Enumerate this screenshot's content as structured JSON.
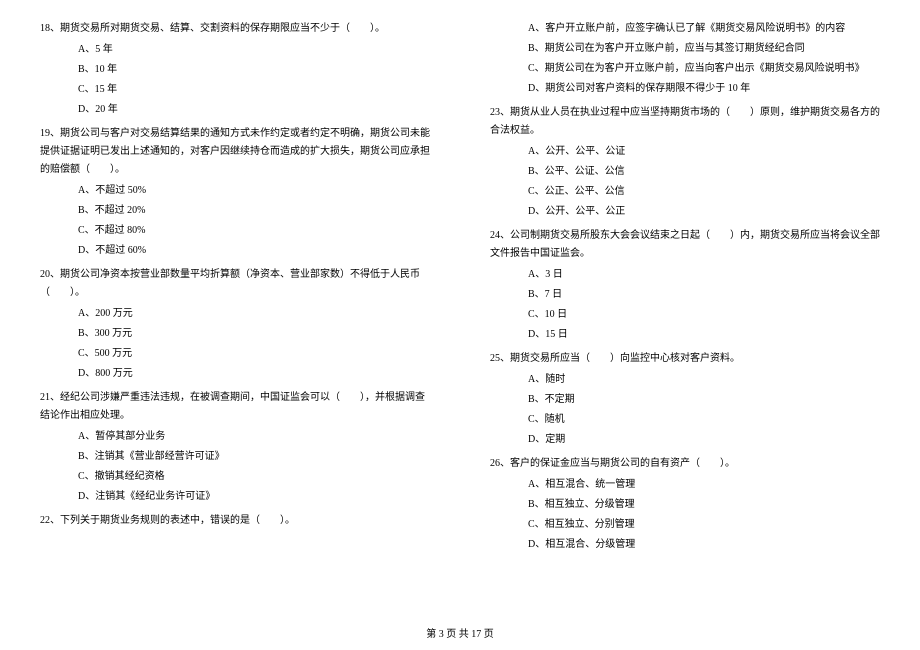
{
  "left_column": {
    "q18": {
      "text": "18、期货交易所对期货交易、结算、交割资料的保存期限应当不少于（　　）。",
      "options": [
        "A、5 年",
        "B、10 年",
        "C、15 年",
        "D、20 年"
      ]
    },
    "q19": {
      "text": "19、期货公司与客户对交易结算结果的通知方式未作约定或者约定不明确，期货公司未能提供证据证明已发出上述通知的，对客户因继续持仓而造成的扩大损失，期货公司应承担的赔偿额（　　）。",
      "options": [
        "A、不超过 50%",
        "B、不超过 20%",
        "C、不超过 80%",
        "D、不超过 60%"
      ]
    },
    "q20": {
      "text": "20、期货公司净资本按营业部数量平均折算额（净资本、营业部家数）不得低于人民币（　　）。",
      "options": [
        "A、200 万元",
        "B、300 万元",
        "C、500 万元",
        "D、800 万元"
      ]
    },
    "q21": {
      "text": "21、经纪公司涉嫌严重违法违规，在被调查期间，中国证监会可以（　　），并根据调查结论作出相应处理。",
      "options": [
        "A、暂停其部分业务",
        "B、注销其《营业部经营许可证》",
        "C、撤销其经纪资格",
        "D、注销其《经纪业务许可证》"
      ]
    },
    "q22": {
      "text": "22、下列关于期货业务规则的表述中，错误的是（　　）。"
    }
  },
  "right_column": {
    "q22_options": [
      "A、客户开立账户前，应签字确认已了解《期货交易风险说明书》的内容",
      "B、期货公司在为客户开立账户前，应当与其签订期货经纪合同",
      "C、期货公司在为客户开立账户前，应当向客户出示《期货交易风险说明书》",
      "D、期货公司对客户资料的保存期限不得少于 10 年"
    ],
    "q23": {
      "text": "23、期货从业人员在执业过程中应当坚持期货市场的（　　）原则，维护期货交易各方的合法权益。",
      "options": [
        "A、公开、公平、公证",
        "B、公平、公证、公信",
        "C、公正、公平、公信",
        "D、公开、公平、公正"
      ]
    },
    "q24": {
      "text": "24、公司制期货交易所股东大会会议结束之日起（　　）内，期货交易所应当将会议全部文件报告中国证监会。",
      "options": [
        "A、3 日",
        "B、7 日",
        "C、10 日",
        "D、15 日"
      ]
    },
    "q25": {
      "text": "25、期货交易所应当（　　）向监控中心核对客户资料。",
      "options": [
        "A、随时",
        "B、不定期",
        "C、随机",
        "D、定期"
      ]
    },
    "q26": {
      "text": "26、客户的保证金应当与期货公司的自有资产（　　）。",
      "options": [
        "A、相互混合、统一管理",
        "B、相互独立、分级管理",
        "C、相互独立、分别管理",
        "D、相互混合、分级管理"
      ]
    }
  },
  "footer": "第 3 页 共 17 页"
}
